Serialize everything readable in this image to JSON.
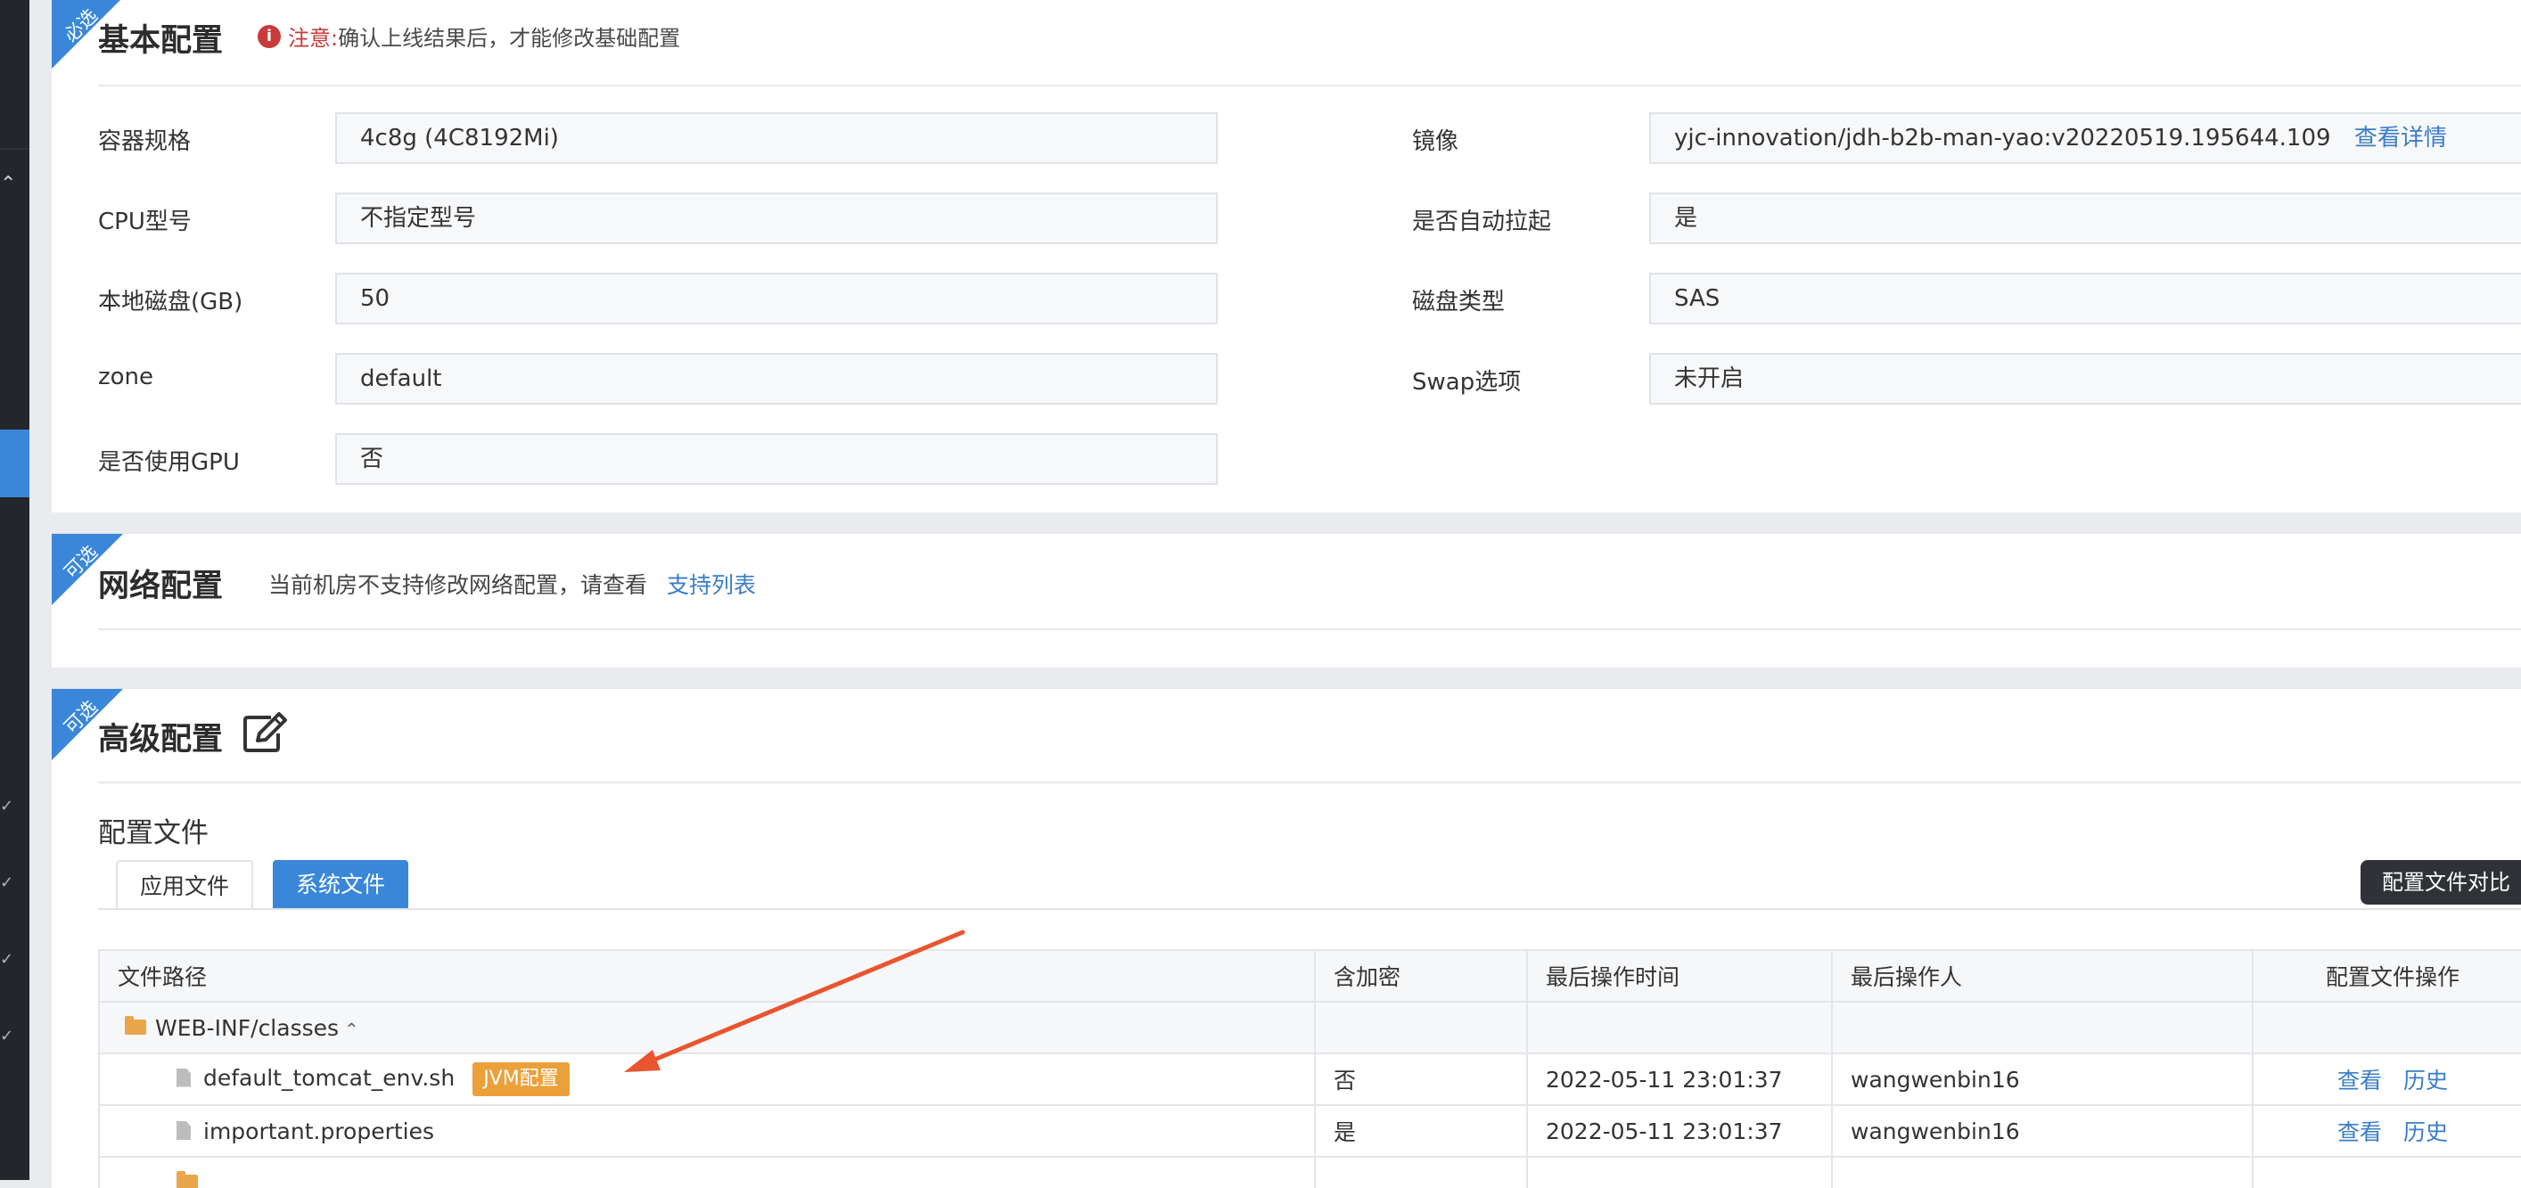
{
  "basic": {
    "ribbon": "必选",
    "title": "基本配置",
    "notice_tag": "注意:",
    "notice_text": "确认上线结果后，才能修改基础配置",
    "left_fields": [
      {
        "label": "容器规格",
        "value": "4c8g (4C8192Mi)"
      },
      {
        "label": "CPU型号",
        "value": "不指定型号"
      },
      {
        "label": "本地磁盘(GB)",
        "value": "50"
      },
      {
        "label": "zone",
        "value": "default"
      },
      {
        "label": "是否使用GPU",
        "value": "否"
      }
    ],
    "right_fields": [
      {
        "label": "镜像",
        "value": "yjc-innovation/jdh-b2b-man-yao:v20220519.195644.109",
        "link": "查看详情"
      },
      {
        "label": "是否自动拉起",
        "value": "是"
      },
      {
        "label": "磁盘类型",
        "value": "SAS"
      },
      {
        "label": "Swap选项",
        "value": "未开启"
      }
    ]
  },
  "network": {
    "ribbon": "可选",
    "title": "网络配置",
    "message": "当前机房不支持修改网络配置，请查看",
    "link": "支持列表"
  },
  "advanced": {
    "ribbon": "可选",
    "title": "高级配置",
    "config_files_heading": "配置文件",
    "tabs": [
      "应用文件",
      "系统文件"
    ],
    "compare_button": "配置文件对比",
    "table": {
      "headers": [
        "文件路径",
        "含加密",
        "最后操作时间",
        "最后操作人",
        "配置文件操作"
      ],
      "folder": "WEB-INF/classes",
      "rows": [
        {
          "name": "default_tomcat_env.sh",
          "badge": "JVM配置",
          "encrypted": "否",
          "time": "2022-05-11 23:01:37",
          "operator": "wangwenbin16",
          "view": "查看",
          "history": "历史"
        },
        {
          "name": "important.properties",
          "encrypted": "是",
          "time": "2022-05-11 23:01:37",
          "operator": "wangwenbin16",
          "view": "查看",
          "history": "历史"
        }
      ]
    }
  },
  "icons": {
    "notice": "info-circle-icon",
    "edit": "edit-icon",
    "folder": "folder-icon",
    "file": "file-icon",
    "caret": "chevron-up-icon"
  },
  "colors": {
    "accent": "#3a87d9",
    "link": "#3a7cc8",
    "warning": "#c93a3a",
    "badge": "#eba03a",
    "annotation_arrow": "#e8552f"
  }
}
